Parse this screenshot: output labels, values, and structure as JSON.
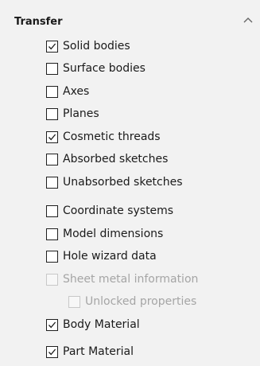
{
  "header": {
    "title": "Transfer",
    "collapse_icon": "chevron-up-icon"
  },
  "options": [
    {
      "label": "Solid bodies",
      "checked": true,
      "enabled": true
    },
    {
      "label": "Surface bodies",
      "checked": false,
      "enabled": true
    },
    {
      "label": "Axes",
      "checked": false,
      "enabled": true
    },
    {
      "label": "Planes",
      "checked": false,
      "enabled": true
    },
    {
      "label": "Cosmetic threads",
      "checked": true,
      "enabled": true
    },
    {
      "label": "Absorbed sketches",
      "checked": false,
      "enabled": true
    },
    {
      "label": "Unabsorbed sketches",
      "checked": false,
      "enabled": true
    },
    {
      "label": "Coordinate systems",
      "checked": false,
      "enabled": true
    },
    {
      "label": "Model dimensions",
      "checked": false,
      "enabled": true
    },
    {
      "label": "Hole wizard data",
      "checked": false,
      "enabled": true
    },
    {
      "label": "Sheet metal information",
      "checked": false,
      "enabled": false
    },
    {
      "label": "Unlocked properties",
      "checked": false,
      "enabled": false
    },
    {
      "label": "Body Material",
      "checked": true,
      "enabled": true
    },
    {
      "label": "Part Material",
      "checked": true,
      "enabled": true
    }
  ],
  "colors": {
    "panel_background": "#f2f2f2",
    "text": "#1a1a1a",
    "disabled_text": "#a5a5a5"
  }
}
